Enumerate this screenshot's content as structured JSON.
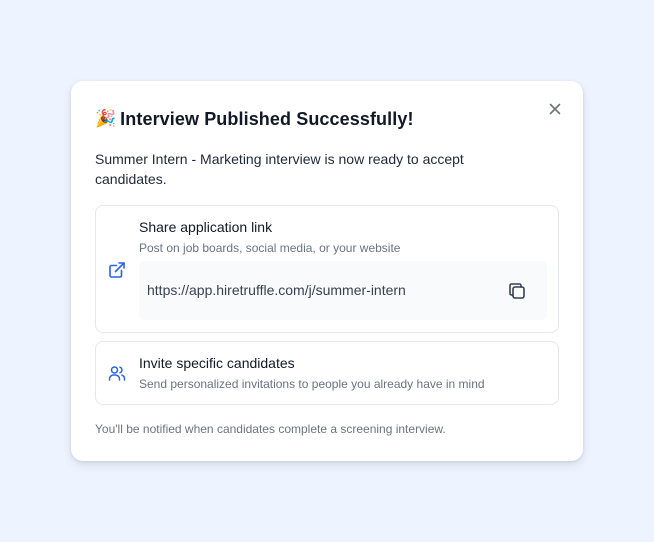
{
  "modal": {
    "title_emoji": "🎉",
    "title": "Interview Published Successfully!",
    "description": "Summer Intern - Marketing interview is now ready to accept candidates.",
    "close_icon": "close-icon",
    "share": {
      "icon": "external-link-icon",
      "title": "Share application link",
      "subtitle": "Post on job boards, social media, or your website",
      "url": "https://app.hiretruffle.com/j/summer-intern",
      "copy_icon": "copy-icon"
    },
    "invite": {
      "icon": "users-icon",
      "title": "Invite specific candidates",
      "subtitle": "Send personalized invitations to people you already have in mind"
    },
    "footer_note": "You'll be notified when candidates complete a screening interview."
  },
  "colors": {
    "page_background": "#eef4ff",
    "accent_icon": "#2563eb",
    "title_text": "#111827",
    "muted_text": "#6b7280"
  }
}
